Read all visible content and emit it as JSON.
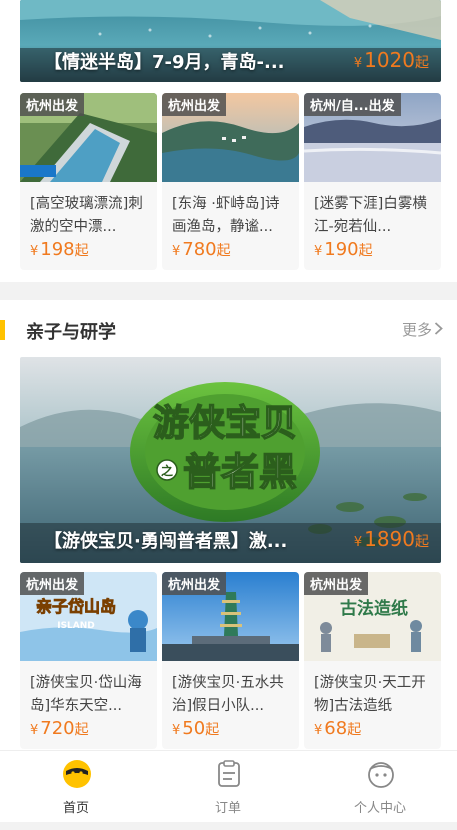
{
  "top_section": {
    "hero": {
      "title": "【情迷半岛】7-9月，青岛-...",
      "price": "1020",
      "price_suffix": "起",
      "currency": "¥"
    },
    "cards": [
      {
        "tag": "杭州出发",
        "title": "[高空玻璃漂流]刺激的空中漂...",
        "price": "198",
        "currency": "¥",
        "price_suffix": "起"
      },
      {
        "tag": "杭州出发",
        "title": "[东海 ·虾峙岛]诗画渔岛，静谧...",
        "price": "780",
        "currency": "¥",
        "price_suffix": "起"
      },
      {
        "tag": "杭州/自...出发",
        "title": "[迷雾下涯]白雾横江-宛若仙...",
        "price": "190",
        "currency": "¥",
        "price_suffix": "起"
      }
    ]
  },
  "kids_section": {
    "title": "亲子与研学",
    "more": "更多",
    "more_icon": "chevron-right-icon",
    "hero": {
      "title": "【游侠宝贝·勇闯普者黑】激...",
      "price": "1890",
      "price_suffix": "起",
      "currency": "¥",
      "poster_line1": "游侠宝贝",
      "poster_line2": "普者黑",
      "poster_badge": "之"
    },
    "cards": [
      {
        "tag": "杭州出发",
        "title": "[游侠宝贝·岱山海岛]华东天空...",
        "price": "720",
        "currency": "¥",
        "price_suffix": "起",
        "poster_text": "亲子岱山岛",
        "poster_sub": "ISLAND"
      },
      {
        "tag": "杭州出发",
        "title": "[游侠宝贝·五水共治]假日小队...",
        "price": "50",
        "currency": "¥",
        "price_suffix": "起"
      },
      {
        "tag": "杭州出发",
        "title": "[游侠宝贝·天工开物]古法造纸",
        "price": "68",
        "currency": "¥",
        "price_suffix": "起",
        "poster_text": "古法造纸"
      }
    ]
  },
  "tabbar": [
    {
      "label": "首页",
      "icon": "home-mascot-icon",
      "active": true
    },
    {
      "label": "订单",
      "icon": "order-icon",
      "active": false
    },
    {
      "label": "个人中心",
      "icon": "profile-icon",
      "active": false
    }
  ],
  "colors": {
    "accent": "#ffc200",
    "price": "#f07a1f"
  }
}
